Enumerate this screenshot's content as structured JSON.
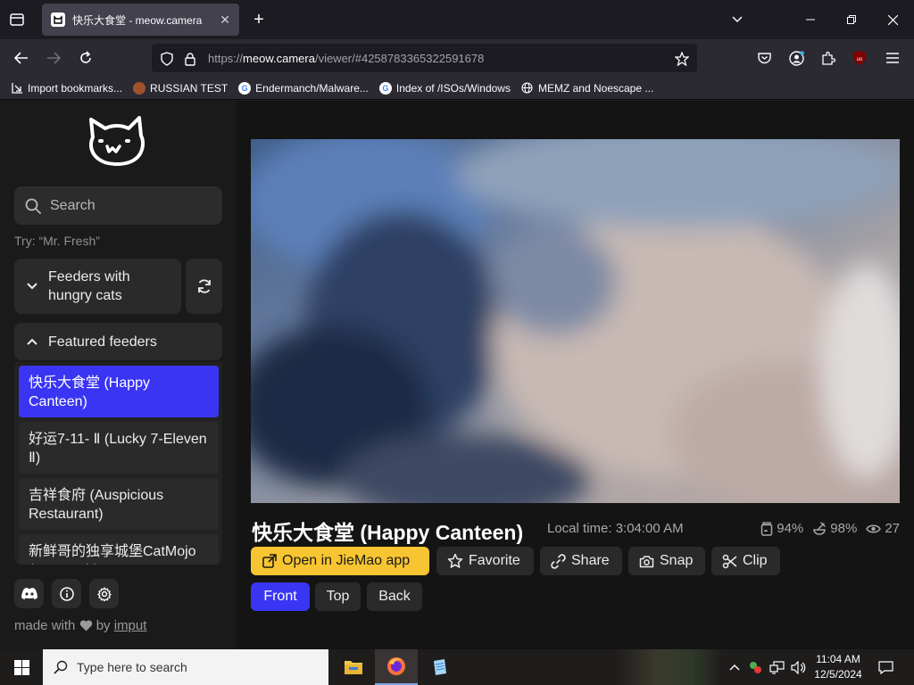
{
  "browser": {
    "tab_title": "快乐大食堂 - meow.camera",
    "url_prefix": "https://",
    "url_domain": "meow.camera",
    "url_path": "/viewer/#4258783365322591678",
    "bookmarks": [
      {
        "label": "Import bookmarks...",
        "icon": "import-icon"
      },
      {
        "label": "RUSSIAN TEST",
        "icon": "github-icon"
      },
      {
        "label": "Endermanch/Malware...",
        "icon": "google-icon"
      },
      {
        "label": "Index of /ISOs/Windows",
        "icon": "google-icon"
      },
      {
        "label": "MEMZ and Noescape ...",
        "icon": "globe-icon"
      }
    ]
  },
  "sidebar": {
    "search_placeholder": "Search",
    "search_hint": "Try: “Mr. Fresh”",
    "hungry_label": "Feeders with hungry cats",
    "featured_label": "Featured feeders",
    "feeders": [
      {
        "name": "快乐大食堂 (Happy Canteen)",
        "active": true
      },
      {
        "name": "好运7-11- Ⅱ (Lucky 7-Eleven Ⅱ)",
        "active": false
      },
      {
        "name": "吉祥食府 (Auspicious Restaurant)",
        "active": false
      },
      {
        "name": "新鲜哥的独享城堡CatMojo (Mr. Fresh)",
        "active": false
      }
    ],
    "made_with": "made with",
    "by": "by",
    "author": "imput"
  },
  "main": {
    "title": "快乐大食堂 (Happy Canteen)",
    "local_time": "Local time: 3:04:00 AM",
    "food_level": "94%",
    "bowl_level": "98%",
    "viewers": "27",
    "actions": {
      "open_app": "Open in JieMao app",
      "favorite": "Favorite",
      "share": "Share",
      "snap": "Snap",
      "clip": "Clip"
    },
    "cameras": [
      "Front",
      "Top",
      "Back"
    ],
    "active_camera": "Front"
  },
  "taskbar": {
    "search_placeholder": "Type here to search",
    "time": "11:04 AM",
    "date": "12/5/2024"
  },
  "colors": {
    "accent_blue": "#3a35f2",
    "accent_yellow": "#f7c531"
  }
}
